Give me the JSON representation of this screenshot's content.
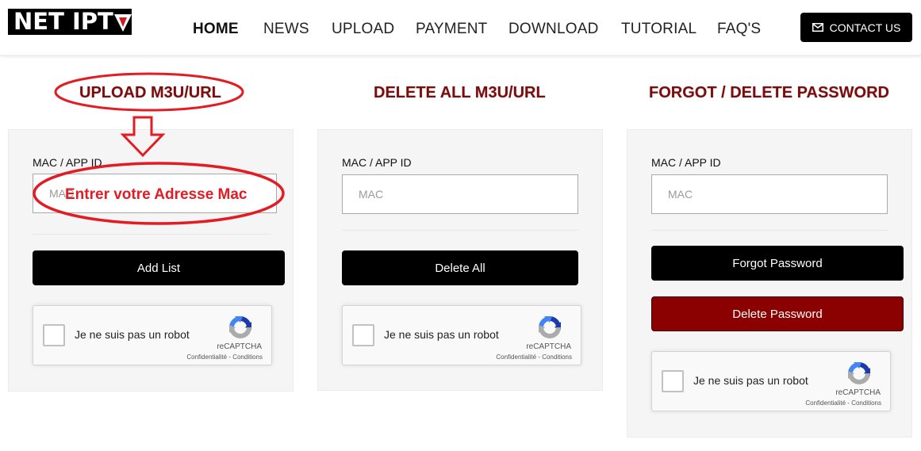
{
  "header": {
    "logo_text": "NET IPT",
    "logo_mark": "V",
    "nav": [
      {
        "label": "HOME",
        "active": true
      },
      {
        "label": "NEWS",
        "active": false
      },
      {
        "label": "UPLOAD",
        "active": false
      },
      {
        "label": "PAYMENT",
        "active": false
      },
      {
        "label": "DOWNLOAD",
        "active": false
      },
      {
        "label": "TUTORIAL",
        "active": false
      },
      {
        "label": "FAQ'S",
        "active": false
      }
    ],
    "contact_button": {
      "label": "CONTACT US",
      "icon": "envelope-icon"
    }
  },
  "sections": [
    {
      "title": "UPLOAD M3U/URL",
      "field_label": "MAC / APP ID",
      "input_placeholder": "MAC",
      "input_value": "",
      "buttons": [
        {
          "label": "Add List",
          "style": "black"
        }
      ]
    },
    {
      "title": "DELETE ALL M3U/URL",
      "field_label": "MAC / APP ID",
      "input_placeholder": "MAC",
      "input_value": "",
      "buttons": [
        {
          "label": "Delete All",
          "style": "black"
        }
      ]
    },
    {
      "title": "FORGOT / DELETE PASSWORD",
      "field_label": "MAC / APP ID",
      "input_placeholder": "MAC",
      "input_value": "",
      "buttons": [
        {
          "label": "Forgot Password",
          "style": "black"
        },
        {
          "label": "Delete Password",
          "style": "red"
        }
      ]
    }
  ],
  "captcha": {
    "label": "Je ne suis pas un robot",
    "brand": "reCAPTCHA",
    "privacy": "Confidentialité",
    "separator": " - ",
    "terms": "Conditions"
  },
  "annotation": {
    "text": "Entrer votre Adresse Mac",
    "color": "#e31b23"
  },
  "colors": {
    "title_dark_red": "#7a0d0d",
    "delete_button": "#8b0000",
    "card_background": "#f5f5f5"
  }
}
